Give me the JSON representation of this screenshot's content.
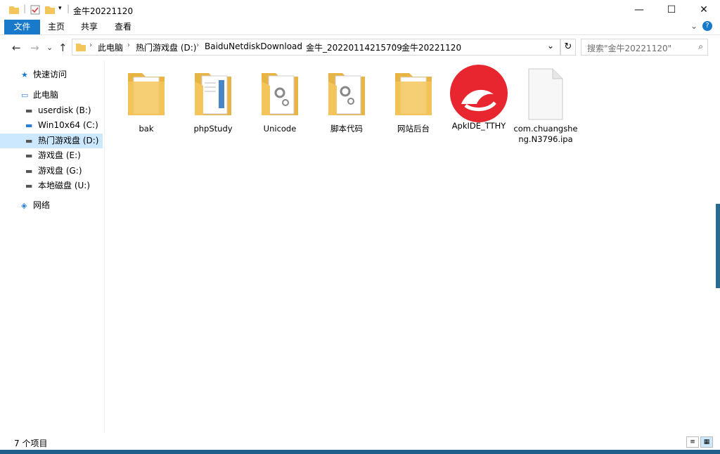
{
  "window": {
    "title": "金牛20221120"
  },
  "titlebar": {
    "minimize": "—",
    "maximize": "☐",
    "close": "✕"
  },
  "ribbon": {
    "tabs": [
      "文件",
      "主页",
      "共享",
      "查看"
    ],
    "expand": "⌄",
    "help": "?"
  },
  "nav": {
    "back": "←",
    "forward": "→",
    "recent": "⌄",
    "up": "↑"
  },
  "address": {
    "crumbs": [
      "此电脑",
      "热门游戏盘 (D:)",
      "BaiduNetdiskDownload",
      "金牛_20220114215709",
      "金牛20221120"
    ],
    "dropdown": "⌄",
    "refresh": "↻"
  },
  "search": {
    "placeholder": "搜索\"金牛20221120\"",
    "icon": "⌕"
  },
  "sidebar": {
    "items": [
      {
        "label": "快速访问",
        "icon": "star-icon",
        "glyph": "★"
      },
      {
        "label": "此电脑",
        "icon": "computer-icon",
        "glyph": "▭"
      },
      {
        "label": "userdisk (B:)",
        "icon": "drive-icon",
        "glyph": "▬"
      },
      {
        "label": "Win10x64 (C:)",
        "icon": "windows-drive-icon",
        "glyph": "▬"
      },
      {
        "label": "热门游戏盘 (D:)",
        "icon": "drive-icon",
        "glyph": "▬"
      },
      {
        "label": "游戏盘 (E:)",
        "icon": "drive-icon",
        "glyph": "▬"
      },
      {
        "label": "游戏盘 (G:)",
        "icon": "drive-icon",
        "glyph": "▬"
      },
      {
        "label": "本地磁盘 (U:)",
        "icon": "drive-icon",
        "glyph": "▬"
      },
      {
        "label": "网络",
        "icon": "network-icon",
        "glyph": "◈"
      }
    ],
    "selected": "热门游戏盘 (D:)"
  },
  "files": [
    {
      "name": "bak",
      "kind": "folder"
    },
    {
      "name": "phpStudy",
      "kind": "folder-doc"
    },
    {
      "name": "Unicode",
      "kind": "folder-gear"
    },
    {
      "name": "脚本代码",
      "kind": "folder-gear"
    },
    {
      "name": "网站后台",
      "kind": "folder"
    },
    {
      "name": "ApkIDE_TTHY",
      "kind": "app"
    },
    {
      "name": "com.chuangsheng.N3796.ipa",
      "kind": "file"
    }
  ],
  "status": {
    "count": "7 个项目"
  },
  "colors": {
    "accent": "#1979ca",
    "folder": "#f4c55b",
    "app": "#e8262f",
    "selected": "#cce8ff"
  }
}
